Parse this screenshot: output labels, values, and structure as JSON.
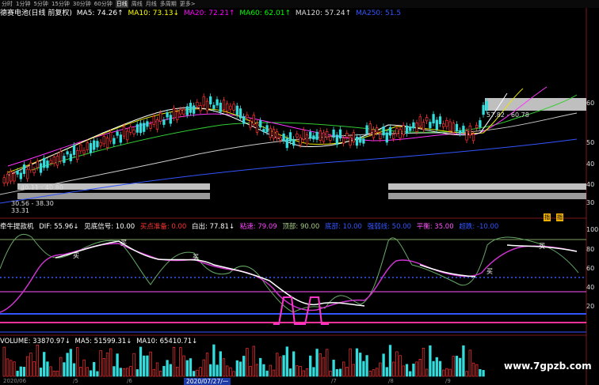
{
  "toolbar": {
    "tabs": [
      "分时",
      "1分钟",
      "5分钟",
      "15分钟",
      "30分钟",
      "60分钟",
      "日线",
      "周线",
      "月线",
      "多周期",
      "更多>"
    ],
    "active_tab": "日线"
  },
  "main_chart": {
    "title": "德赛电池(日线 前复权)",
    "ma5": "MA5: 74.26↑",
    "ma10": "MA10: 73.13↓",
    "ma20": "MA20: 72.21↑",
    "ma60": "MA60: 62.01↑",
    "ma120": "MA120: 57.24↑",
    "ma250": "MA250: 51.5",
    "box_labels": [
      "40.11 - 40.80",
      "30.56 - 38.30",
      "33.31",
      "57.82 - 60.78"
    ],
    "y_axis": [
      "60",
      "50",
      "40",
      "40",
      "30"
    ],
    "colors": {
      "ma5": "#ffffff",
      "ma10": "#ffff00",
      "ma20": "#ff00ff",
      "ma60": "#00ff00",
      "ma120": "#dddddd",
      "ma250": "#3355ff"
    }
  },
  "indicator": {
    "name": "牵牛提款机",
    "dif": "DIF: 55.96↓",
    "signal": "见底信号: 10.00",
    "buy_prep": "买点准备: 0.00",
    "white_out": "白出: 77.81↓",
    "pinch": "粘速: 79.09",
    "top": "顶部: 90.00",
    "bottom": "底部: 10.00",
    "balance_line": "强弱线: 50.00",
    "flat": "平衡: 35.00",
    "cross": "超跌: -10.00",
    "y_axis": [
      "100",
      "80",
      "60",
      "40",
      "20"
    ],
    "buy_marks": [
      "买",
      "买",
      "买",
      "买",
      "买"
    ],
    "signals": [
      "指",
      "指"
    ]
  },
  "volume": {
    "label": "VOLUME: 33870.97↓",
    "ma5": "MA5: 51599.31↓",
    "ma10": "MA10: 65410.71↓"
  },
  "x_axis": {
    "date_box": "2020/07/27/一",
    "labels": [
      "2020/06",
      "/5",
      "/6",
      "/7",
      "/8",
      "/9"
    ]
  },
  "watermark": "www.7gpzb.com"
}
